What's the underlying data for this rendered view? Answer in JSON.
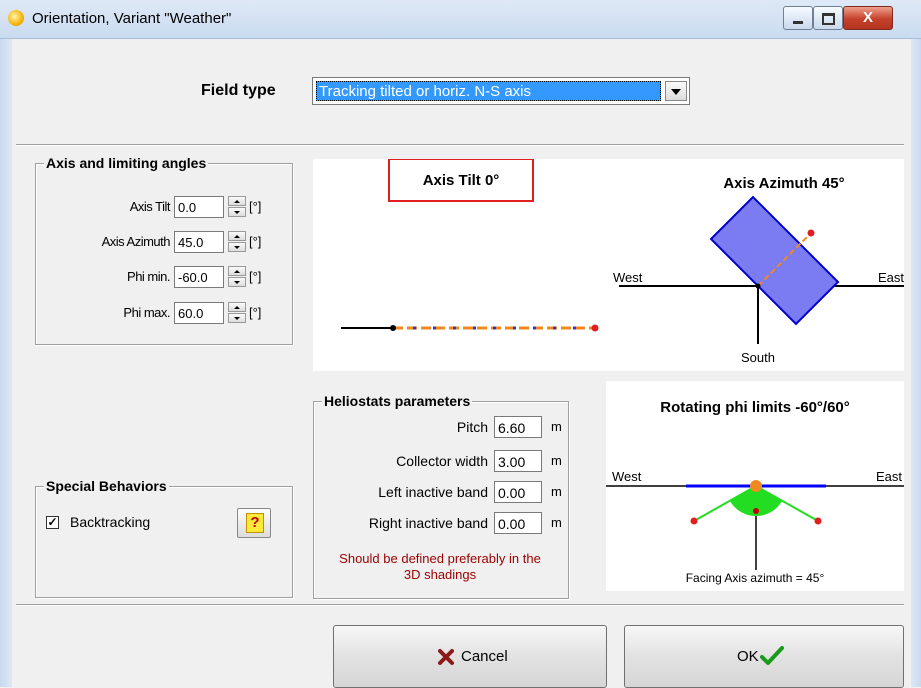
{
  "window": {
    "title": "Orientation, Variant \"Weather\"",
    "close_glyph": "X",
    "icons": [
      "sun-app-icon",
      "minimize-icon",
      "maximize-icon",
      "close-icon"
    ]
  },
  "field_type": {
    "label": "Field type",
    "selected": "Tracking tilted or horiz. N-S axis"
  },
  "axis_group": {
    "title": "Axis and limiting angles",
    "fields": [
      {
        "label": "Axis Tilt",
        "value": "0.0",
        "unit": "[°]"
      },
      {
        "label": "Axis Azimuth",
        "value": "45.0",
        "unit": "[°]"
      },
      {
        "label": "Phi min.",
        "value": "-60.0",
        "unit": "[°]"
      },
      {
        "label": "Phi max.",
        "value": "60.0",
        "unit": "[°]"
      }
    ]
  },
  "tilt_diagram": {
    "title": "Axis Tilt 0°"
  },
  "azimuth_diagram": {
    "title": "Axis Azimuth 45°",
    "west": "West",
    "east": "East",
    "south": "South"
  },
  "helio_group": {
    "title": "Heliostats parameters",
    "fields": [
      {
        "label": "Pitch",
        "value": "6.60",
        "unit": "m"
      },
      {
        "label": "Collector width",
        "value": "3.00",
        "unit": "m"
      },
      {
        "label": "Left inactive band",
        "value": "0.00",
        "unit": "m"
      },
      {
        "label": "Right inactive band",
        "value": "0.00",
        "unit": "m"
      }
    ],
    "note_line1": "Should be defined preferably in the",
    "note_line2": "3D shadings"
  },
  "phi_diagram": {
    "title": "Rotating phi limits -60°/60°",
    "west": "West",
    "east": "East",
    "caption": "Facing Axis azimuth = 45°"
  },
  "special_group": {
    "title": "Special Behaviors",
    "backtracking_label": "Backtracking",
    "backtracking_checked": true,
    "check_glyph": "✓",
    "help_glyph": "?"
  },
  "buttons": {
    "cancel": "Cancel",
    "ok": "OK"
  },
  "colors": {
    "panel_blue": "#7b7bf2",
    "accent_red": "#e02020",
    "accent_orange": "#f08a1e",
    "accent_green": "#22dd22",
    "select_blue": "#3399ff"
  }
}
